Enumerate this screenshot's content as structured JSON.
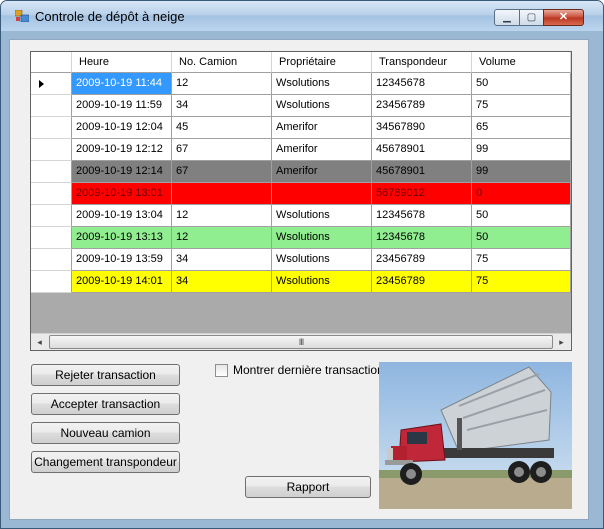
{
  "window": {
    "title": "Controle de dépôt à neige",
    "minimize_glyph": "▁",
    "maximize_glyph": "▢",
    "close_glyph": "✕",
    "app_icon": "app-window-icon"
  },
  "grid": {
    "columns": [
      "Heure",
      "No. Camion",
      "Propriétaire",
      "Transpondeur",
      "Volume"
    ],
    "rows": [
      {
        "cells": [
          "2009-10-19 11:44",
          "12",
          "Wsolutions",
          "12345678",
          "50"
        ],
        "bg": "#ffffff",
        "selected_first": true,
        "current": true
      },
      {
        "cells": [
          "2009-10-19 11:59",
          "34",
          "Wsolutions",
          "23456789",
          "75"
        ],
        "bg": "#ffffff"
      },
      {
        "cells": [
          "2009-10-19 12:04",
          "45",
          "Amerifor",
          "34567890",
          "65"
        ],
        "bg": "#ffffff"
      },
      {
        "cells": [
          "2009-10-19 12:12",
          "67",
          "Amerifor",
          "45678901",
          "99"
        ],
        "bg": "#ffffff"
      },
      {
        "cells": [
          "2009-10-19 12:14",
          "67",
          "Amerifor",
          "45678901",
          "99"
        ],
        "bg": "#808080"
      },
      {
        "cells": [
          "2009-10-19 13:01",
          "",
          "",
          "56789012",
          "0"
        ],
        "bg": "#ff0000"
      },
      {
        "cells": [
          "2009-10-19 13:04",
          "12",
          "Wsolutions",
          "12345678",
          "50"
        ],
        "bg": "#ffffff"
      },
      {
        "cells": [
          "2009-10-19 13:13",
          "12",
          "Wsolutions",
          "12345678",
          "50"
        ],
        "bg": "#90ee90"
      },
      {
        "cells": [
          "2009-10-19 13:59",
          "34",
          "Wsolutions",
          "23456789",
          "75"
        ],
        "bg": "#ffffff"
      },
      {
        "cells": [
          "2009-10-19 14:01",
          "34",
          "Wsolutions",
          "23456789",
          "75"
        ],
        "bg": "#ffff00"
      }
    ],
    "selection_color": "#3399ff",
    "scroll_left_glyph": "◂",
    "scroll_right_glyph": "▸",
    "scroll_grip": "III"
  },
  "buttons": {
    "reject": "Rejeter transaction",
    "accept": "Accepter transaction",
    "new_truck": "Nouveau camion",
    "change_transponder": "Changement transpondeur",
    "report": "Rapport"
  },
  "show_last": {
    "label": "Montrer dernière transaction",
    "checked": false
  },
  "photo": {
    "icon": "dump-truck-photo"
  }
}
